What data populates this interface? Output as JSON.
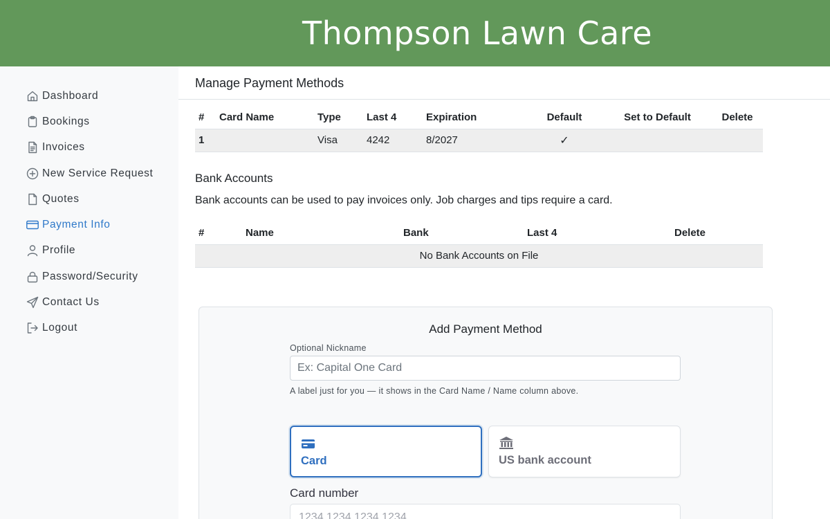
{
  "header": {
    "title": "Thompson Lawn Care"
  },
  "sidebar": {
    "items": [
      {
        "label": "Dashboard",
        "icon": "home-icon",
        "active": false
      },
      {
        "label": "Bookings",
        "icon": "clipboard-icon",
        "active": false
      },
      {
        "label": "Invoices",
        "icon": "document-icon",
        "active": false
      },
      {
        "label": "New Service Request",
        "icon": "plus-circle-icon",
        "active": false
      },
      {
        "label": "Quotes",
        "icon": "file-icon",
        "active": false
      },
      {
        "label": "Payment Info",
        "icon": "credit-card-icon",
        "active": true
      },
      {
        "label": "Profile",
        "icon": "person-icon",
        "active": false
      },
      {
        "label": "Password/Security",
        "icon": "lock-icon",
        "active": false
      },
      {
        "label": "Contact Us",
        "icon": "send-icon",
        "active": false
      },
      {
        "label": "Logout",
        "icon": "logout-icon",
        "active": false
      }
    ],
    "active_color": "#2f79c9"
  },
  "payment_methods": {
    "title": "Manage Payment Methods",
    "columns": [
      "#",
      "Card Name",
      "Type",
      "Last 4",
      "Expiration",
      "Default",
      "Set to Default",
      "Delete"
    ],
    "rows": [
      {
        "num": "1",
        "card_name": "",
        "type": "Visa",
        "last4": "4242",
        "expiration": "8/2027",
        "default": "✓",
        "set_default": "",
        "delete": ""
      }
    ]
  },
  "bank_accounts": {
    "title": "Bank Accounts",
    "note": "Bank accounts can be used to pay invoices only. Job charges and tips require a card.",
    "columns": [
      "#",
      "Name",
      "Bank",
      "Last 4",
      "Delete"
    ],
    "empty_message": "No Bank Accounts on File"
  },
  "add_payment": {
    "title": "Add Payment Method",
    "nickname_label": "Optional Nickname",
    "nickname_placeholder": "Ex: Capital One Card",
    "nickname_help": "A label just for you — it shows in the Card Name / Name column above.",
    "tabs": [
      {
        "label": "Card",
        "icon": "card-icon",
        "selected": true
      },
      {
        "label": "US bank account",
        "icon": "bank-icon",
        "selected": false
      }
    ],
    "card_number_label": "Card number",
    "card_number_placeholder": "1234 1234 1234 1234"
  },
  "colors": {
    "header_bg": "#62985a",
    "accent": "#2f6fbf"
  }
}
